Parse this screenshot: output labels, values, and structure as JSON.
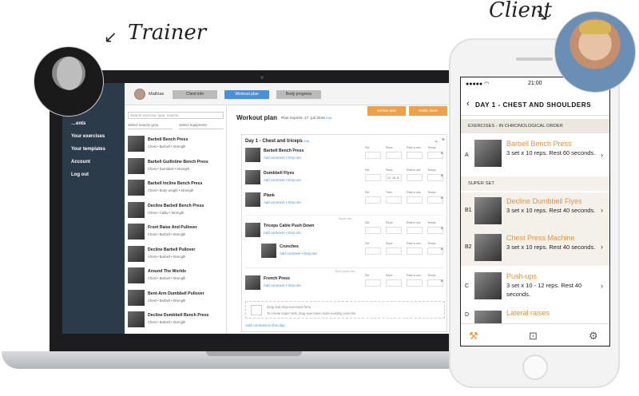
{
  "labels": {
    "trainer": "Trainer",
    "client": "Client"
  },
  "web": {
    "user": "Mathias",
    "tabs": [
      "Client info",
      "Workout plan",
      "Body progress"
    ],
    "sidebar": [
      "…ents",
      "Your exercises",
      "Your templates",
      "Account",
      "Log out"
    ],
    "search_placeholder": "Search exercise, type, muscle...",
    "filter_muscle": "Select muscle grou",
    "filter_equipment": "Select equipment",
    "exercises": [
      {
        "name": "Barbell Bench Press",
        "sub": "Chest • Barbell • Strength"
      },
      {
        "name": "Barbell Guillotine Bench Press",
        "sub": "Chest • Dumbbell • Strength"
      },
      {
        "name": "Barbell Incline Bench Press",
        "sub": "Chest • Body weight • Strength"
      },
      {
        "name": "Decline Barbell Bench Press",
        "sub": "Chest • Cable • Strength"
      },
      {
        "name": "Front Raise And Pullover",
        "sub": "Chest • Barbell • Strength"
      },
      {
        "name": "Decline Barbell Pullover",
        "sub": "Chest • Barbell • Strength"
      },
      {
        "name": "Around The Worlds",
        "sub": "Chest • Barbell • Strength"
      },
      {
        "name": "Bent-Arm Dumbbell Pullover",
        "sub": "Chest • Barbell • Strength"
      },
      {
        "name": "Decline Dumbbell Bench Press",
        "sub": "Chest • Barbell • Strength"
      }
    ],
    "plan_title": "Workout plan",
    "plan_expires": "Plan expires: 17. juli 2016",
    "edit": "Edit",
    "archive": "Archive plan",
    "notify": "Notify client",
    "day_title": "Day 1 - Chest and triceps",
    "plan_items": [
      {
        "name": "Barbell Bench Press",
        "links": "Add comment • Drop set",
        "cols": [
          "Set",
          "Reps",
          "Rest in sec",
          "Tempo"
        ],
        "vals": [
          "",
          "",
          "",
          ""
        ]
      },
      {
        "name": "Dumbbell Flyes",
        "links": "Add comment • Drop set",
        "cols": [
          "Set",
          "Reps",
          "Rest in sec",
          "Tempo"
        ],
        "vals": [
          "",
          "12, 10, 8",
          "",
          ""
        ]
      },
      {
        "name": "Plank",
        "links": "Add comment • Drop set",
        "cols": [
          "Set",
          "Time",
          "Rest in sec",
          "Tempo"
        ],
        "vals": [
          "",
          "",
          "",
          ""
        ]
      },
      {
        "name": "Triceps Cable Push Down",
        "links": "Add comment • Drop set",
        "cols": [
          "Set",
          "Reps",
          "Rest in sec",
          "Tempo"
        ],
        "vals": [
          "",
          "",
          "",
          ""
        ]
      },
      {
        "name": "Crunches",
        "links": "Add comment • Drop set",
        "cols": [
          "Set",
          "Reps",
          "Rest in sec",
          "Tempo"
        ],
        "vals": [
          "",
          "",
          "",
          ""
        ]
      },
      {
        "name": "French Press",
        "links": "Add comment • Drop set",
        "cols": [
          "Set",
          "Reps",
          "Rest in sec",
          "Tempo"
        ],
        "vals": [
          "",
          "",
          "",
          ""
        ]
      }
    ],
    "super_set": "Super set",
    "end_super_set": "End super set",
    "drop_text": "Drag and drop exercises here",
    "drop_hint": "To create super sets, drag exercises under existing exercise",
    "add_comment_day": "Add comment to this day"
  },
  "phone": {
    "time": "21:00",
    "title": "DAY 1 - CHEST AND SHOULDERS",
    "section1": "EXERCISES - IN CHRONOLOGICAL ORDER",
    "section2": "SUPER SET",
    "items": [
      {
        "letter": "A",
        "name": "Barbell Bench Press",
        "desc": "3 set x 10 reps. Rest 60 seconds."
      },
      {
        "letter": "B1",
        "name": "Decline Dumbbell Flyes",
        "desc": "3 set x 10 reps. Rest 40 seconds."
      },
      {
        "letter": "B2",
        "name": "Chest Press Machine",
        "desc": "3 set x 10 reps. Rest 40 seconds."
      },
      {
        "letter": "C",
        "name": "Push-ups",
        "desc": "3 set x 10 - 12 reps. Rest 40 seconds."
      },
      {
        "letter": "D",
        "name": "Lateral raises",
        "desc": ""
      }
    ]
  },
  "colors": {
    "accent": "#e8923a",
    "blue": "#4a90d9",
    "sidebar": "#2c3b4a"
  }
}
